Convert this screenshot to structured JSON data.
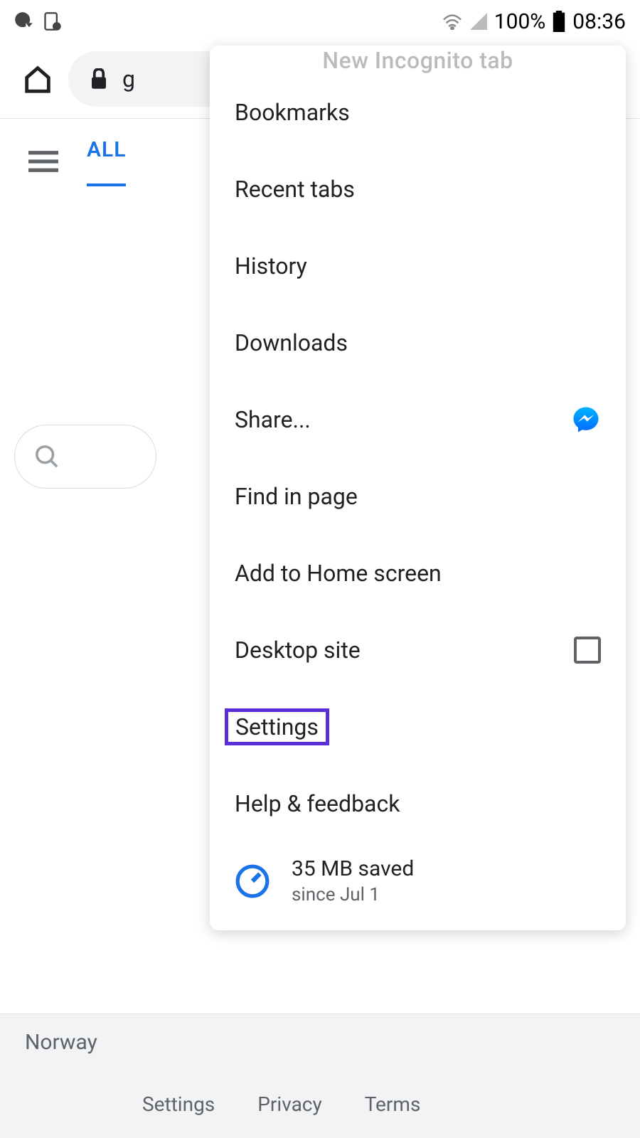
{
  "status": {
    "battery_text": "100%",
    "time": "08:36"
  },
  "browser": {
    "url_fragment": "g"
  },
  "tabs": {
    "active_label": "ALL"
  },
  "menu": {
    "clipped_top": "New Incognito tab",
    "items": {
      "bookmarks": "Bookmarks",
      "recent_tabs": "Recent tabs",
      "history": "History",
      "downloads": "Downloads",
      "share": "Share...",
      "find_in_page": "Find in page",
      "add_home": "Add to Home screen",
      "desktop_site": "Desktop site",
      "settings": "Settings",
      "help": "Help & feedback"
    },
    "data_saver": {
      "title": "35 MB saved",
      "subtitle": "since Jul 1"
    }
  },
  "footer": {
    "location": "Norway",
    "links": {
      "settings": "Settings",
      "privacy": "Privacy",
      "terms": "Terms"
    }
  }
}
